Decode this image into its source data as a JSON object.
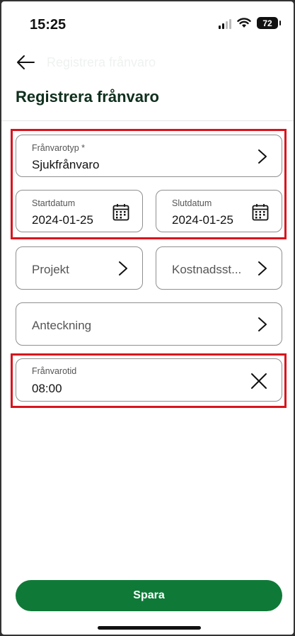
{
  "status_bar": {
    "time": "15:25",
    "battery": "72"
  },
  "header": {
    "ghost_title": "Registrera frånvaro",
    "title": "Registrera frånvaro"
  },
  "form": {
    "absence_type": {
      "label": "Frånvarotyp *",
      "value": "Sjukfrånvaro"
    },
    "start_date": {
      "label": "Startdatum",
      "value": "2024-01-25"
    },
    "end_date": {
      "label": "Slutdatum",
      "value": "2024-01-25"
    },
    "project": {
      "placeholder": "Projekt"
    },
    "cost_center": {
      "placeholder": "Kostnadsst..."
    },
    "note": {
      "placeholder": "Anteckning"
    },
    "absence_time": {
      "label": "Frånvarotid",
      "value": "08:00"
    }
  },
  "actions": {
    "save_label": "Spara"
  },
  "icons": {
    "back": "arrow-left-icon",
    "chevron": "chevron-right-icon",
    "calendar": "calendar-icon",
    "clear": "close-icon",
    "wifi": "wifi-icon",
    "signal": "signal-icon",
    "battery": "battery-icon"
  },
  "colors": {
    "primary": "#0f7a38",
    "title": "#0f2f1d",
    "highlight": "#d8141c",
    "border": "#8f8f8f"
  }
}
